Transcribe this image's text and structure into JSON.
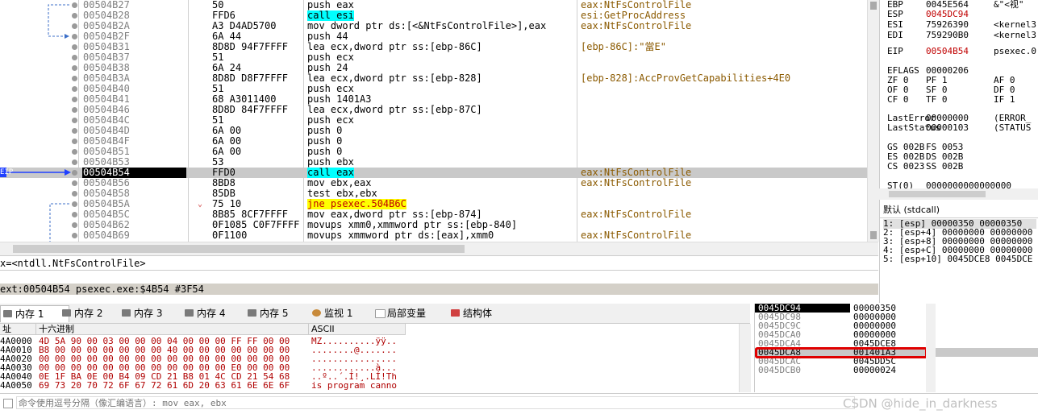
{
  "disasm": {
    "rows": [
      {
        "addr": "00504B27",
        "bytes": "50",
        "instr": "push eax",
        "comment": "eax:NtFsControlFile"
      },
      {
        "addr": "00504B28",
        "bytes": "FFD6",
        "instr": "call esi",
        "comment": "esi:GetProcAddress"
      },
      {
        "addr": "00504B2A",
        "bytes": "A3 D4AD5700",
        "instr": "mov dword ptr ds:[<&NtFsControlFile>],eax",
        "comment": "eax:NtFsControlFile"
      },
      {
        "addr": "00504B2F",
        "bytes": "6A 44",
        "instr": "push 44",
        "comment": ""
      },
      {
        "addr": "00504B31",
        "bytes": "8D8D 94F7FFFF",
        "instr": "lea ecx,dword ptr ss:[ebp-86C]",
        "comment": "[ebp-86C]:\"當E\""
      },
      {
        "addr": "00504B37",
        "bytes": "51",
        "instr": "push ecx",
        "comment": ""
      },
      {
        "addr": "00504B38",
        "bytes": "6A 24",
        "instr": "push 24",
        "comment": ""
      },
      {
        "addr": "00504B3A",
        "bytes": "8D8D D8F7FFFF",
        "instr": "lea ecx,dword ptr ss:[ebp-828]",
        "comment": "[ebp-828]:AccProvGetCapabilities+4E0"
      },
      {
        "addr": "00504B40",
        "bytes": "51",
        "instr": "push ecx",
        "comment": ""
      },
      {
        "addr": "00504B41",
        "bytes": "68 A3011400",
        "instr": "push 1401A3",
        "comment": ""
      },
      {
        "addr": "00504B46",
        "bytes": "8D8D 84F7FFFF",
        "instr": "lea ecx,dword ptr ss:[ebp-87C]",
        "comment": ""
      },
      {
        "addr": "00504B4C",
        "bytes": "51",
        "instr": "push ecx",
        "comment": ""
      },
      {
        "addr": "00504B4D",
        "bytes": "6A 00",
        "instr": "push 0",
        "comment": ""
      },
      {
        "addr": "00504B4F",
        "bytes": "6A 00",
        "instr": "push 0",
        "comment": ""
      },
      {
        "addr": "00504B51",
        "bytes": "6A 00",
        "instr": "push 0",
        "comment": ""
      },
      {
        "addr": "00504B53",
        "bytes": "53",
        "instr": "push ebx",
        "comment": ""
      },
      {
        "addr": "00504B54",
        "bytes": "FFD0",
        "instr": "call eax",
        "comment": "eax:NtFsControlFile"
      },
      {
        "addr": "00504B56",
        "bytes": "8BD8",
        "instr": "mov ebx,eax",
        "comment": "eax:NtFsControlFile"
      },
      {
        "addr": "00504B58",
        "bytes": "85DB",
        "instr": "test ebx,ebx",
        "comment": ""
      },
      {
        "addr": "00504B5A",
        "bytes": "75 10",
        "instr": "jne psexec.504B6C",
        "comment": ""
      },
      {
        "addr": "00504B5C",
        "bytes": "8B85 8CF7FFFF",
        "instr": "mov eax,dword ptr ss:[ebp-874]",
        "comment": "eax:NtFsControlFile"
      },
      {
        "addr": "00504B62",
        "bytes": "0F1085 C0F7FFFF",
        "instr": "movups xmm0,xmmword ptr ss:[ebp-840]",
        "comment": ""
      },
      {
        "addr": "00504B69",
        "bytes": "0F1100",
        "instr": "movups xmmword ptr ds:[eax],xmm0",
        "comment": "eax:NtFsControlFile"
      }
    ],
    "eip_label": "EIP"
  },
  "info": {
    "line1": "x=<ntdll.NtFsControlFile>",
    "line2": "ext:00504B54 psexec.exe:$4B54 #3F54"
  },
  "registers": {
    "lines": [
      {
        "name": "EBP",
        "value": "0045E564",
        "note": "&\"<视\""
      },
      {
        "name": "ESP",
        "value": "0045DC94",
        "note": ""
      },
      {
        "name": "ESI",
        "value": "75926390",
        "note": "<kernel3"
      },
      {
        "name": "EDI",
        "value": "759290B0",
        "note": "<kernel3"
      },
      {
        "name": "EIP",
        "value": "00504B54",
        "note": "psexec.0"
      },
      {
        "name": "EFLAGS",
        "value": "00000206",
        "note": ""
      },
      {
        "name": "ZF 0",
        "value": "PF 1",
        "note": "AF 0"
      },
      {
        "name": "OF 0",
        "value": "SF 0",
        "note": "DF 0"
      },
      {
        "name": "CF 0",
        "value": "TF 0",
        "note": "IF 1"
      },
      {
        "name": "LastError",
        "value": "00000000",
        "note": "(ERROR_"
      },
      {
        "name": "LastStatus",
        "value": "00000103",
        "note": "(STATUS"
      },
      {
        "name": "GS 002B",
        "value": "FS 0053",
        "note": ""
      },
      {
        "name": "ES 002B",
        "value": "DS 002B",
        "note": ""
      },
      {
        "name": "CS 0023",
        "value": "SS 002B",
        "note": ""
      },
      {
        "name": "ST(0)",
        "value": "0000000000000000",
        "note": ""
      }
    ],
    "callconv": "默认 (stdcall)",
    "args": [
      "1: [esp] 00000350 00000350",
      "2: [esp+4] 00000000 00000000",
      "3: [esp+8] 00000000 00000000",
      "4: [esp+C] 00000000 00000000",
      "5: [esp+10] 0045DCE8 0045DCE"
    ]
  },
  "tabs": [
    {
      "label": "内存 1",
      "icon": "memory-icon"
    },
    {
      "label": "内存 2",
      "icon": "memory-icon"
    },
    {
      "label": "内存 3",
      "icon": "memory-icon"
    },
    {
      "label": "内存 4",
      "icon": "memory-icon"
    },
    {
      "label": "内存 5",
      "icon": "memory-icon"
    },
    {
      "label": "监视 1",
      "icon": "watch-icon"
    },
    {
      "label": "局部变量",
      "icon": "locals-icon"
    },
    {
      "label": "结构体",
      "icon": "struct-icon"
    }
  ],
  "dump": {
    "col_addr": "址",
    "col_hex": "十六进制",
    "col_ascii": "ASCII",
    "rows": [
      {
        "addr": "4A0000",
        "hex": "4D 5A 90 00 03 00 00 00 04 00 00 00 FF FF 00 00",
        "ascii": "MZ..........ÿÿ.."
      },
      {
        "addr": "4A0010",
        "hex": "B8 00 00 00 00 00 00 00 40 00 00 00 00 00 00 00",
        "ascii": "........@......."
      },
      {
        "addr": "4A0020",
        "hex": "00 00 00 00 00 00 00 00 00 00 00 00 00 00 00 00",
        "ascii": "................"
      },
      {
        "addr": "4A0030",
        "hex": "00 00 00 00 00 00 00 00 00 00 00 00 E0 00 00 00",
        "ascii": "............à..."
      },
      {
        "addr": "4A0040",
        "hex": "0E 1F BA 0E 00 B4 09 CD 21 B8 01 4C CD 21 54 68",
        "ascii": "..º..´.Í!¸.LÍ!Th"
      },
      {
        "addr": "4A0050",
        "hex": "69 73 20 70 72 6F 67 72 61 6D 20 63 61 6E 6E 6F",
        "ascii": "is program canno"
      }
    ]
  },
  "stack": {
    "rows": [
      {
        "addr": "0045DC94",
        "value": "00000350"
      },
      {
        "addr": "0045DC98",
        "value": "00000000"
      },
      {
        "addr": "0045DC9C",
        "value": "00000000"
      },
      {
        "addr": "0045DCA0",
        "value": "00000000"
      },
      {
        "addr": "0045DCA4",
        "value": "0045DCE8"
      },
      {
        "addr": "0045DCA8",
        "value": "001401A3"
      },
      {
        "addr": "0045DCAC",
        "value": "0045DD5C"
      },
      {
        "addr": "0045DCB0",
        "value": "00000024"
      }
    ]
  },
  "cmd": {
    "placeholder": "命令使用逗号分隔（像汇编语言）: mov eax, ebx"
  },
  "watermark": "CSDN @hide_in_darkness",
  "colors": {
    "highlight_box": "#e00000",
    "cyan": "#00ffff",
    "yellow": "#ffff00"
  }
}
